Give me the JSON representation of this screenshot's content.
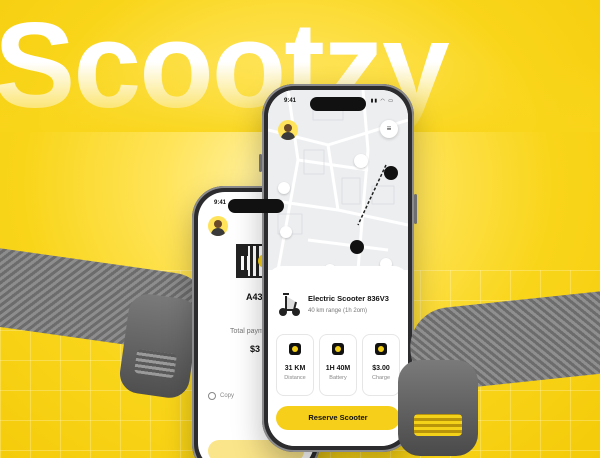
{
  "brand": {
    "title": "Scootzy"
  },
  "back_phone": {
    "status_time": "9:41",
    "code": "A43",
    "payment_label": "Total paym",
    "payment_value": "$3",
    "copy_label": "Copy"
  },
  "front_phone": {
    "status_time": "9:41",
    "status_icons": "▮▮ ◠ ▭",
    "menu_icon": "≡",
    "scooter": {
      "name": "Electric Scooter 836V3",
      "range": "40 km range (1h 2om)"
    },
    "stats": [
      {
        "icon": "distance-icon",
        "value": "31 KM",
        "label": "Distance"
      },
      {
        "icon": "battery-icon",
        "value": "1H 40M",
        "label": "Battery"
      },
      {
        "icon": "charge-icon",
        "value": "$3.00",
        "label": "Charge"
      }
    ],
    "reserve_label": "Reserve Scooter"
  },
  "colors": {
    "accent": "#f6cf1a",
    "background": "#f9d51a",
    "text": "#111111"
  }
}
